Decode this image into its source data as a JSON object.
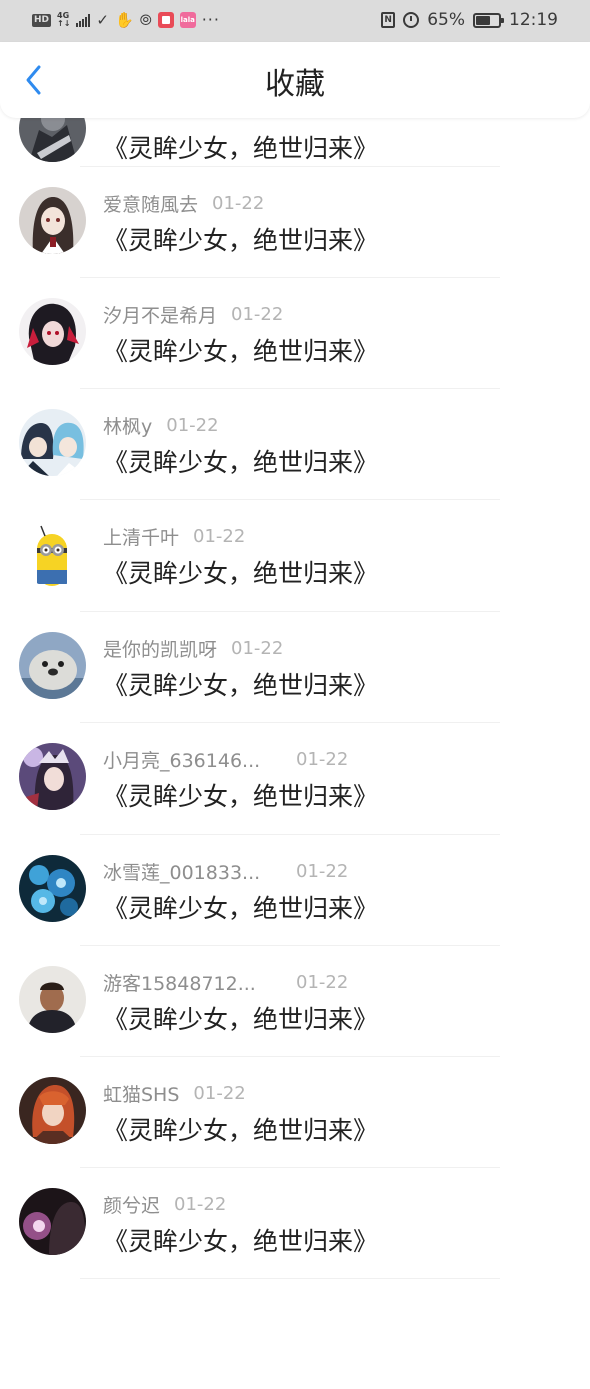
{
  "status_bar": {
    "hd": "HD",
    "network": "4G",
    "battery_text": "65%",
    "battery_level": 0.65,
    "time": "12:19",
    "nfc": "N",
    "overflow": "···"
  },
  "header": {
    "title": "收藏"
  },
  "items": [
    {
      "name": "",
      "date": "",
      "title": "《灵眸少女，绝世归来》"
    },
    {
      "name": "爱意随風去",
      "date": "01-22",
      "title": "《灵眸少女，绝世归来》"
    },
    {
      "name": "汐月不是希月",
      "date": "01-22",
      "title": "《灵眸少女，绝世归来》"
    },
    {
      "name": "林枫y",
      "date": "01-22",
      "title": "《灵眸少女，绝世归来》"
    },
    {
      "name": "上清千叶",
      "date": "01-22",
      "title": "《灵眸少女，绝世归来》"
    },
    {
      "name": "是你的凯凯呀",
      "date": "01-22",
      "title": "《灵眸少女，绝世归来》"
    },
    {
      "name": "小月亮_636146...",
      "date": "01-22",
      "title": "《灵眸少女，绝世归来》"
    },
    {
      "name": "冰雪莲_001833...",
      "date": "01-22",
      "title": "《灵眸少女，绝世归来》"
    },
    {
      "name": "游客15848712...",
      "date": "01-22",
      "title": "《灵眸少女，绝世归来》"
    },
    {
      "name": "虹猫SHS",
      "date": "01-22",
      "title": "《灵眸少女，绝世归来》"
    },
    {
      "name": "颜兮迟",
      "date": "01-22",
      "title": "《灵眸少女，绝世归来》"
    }
  ]
}
